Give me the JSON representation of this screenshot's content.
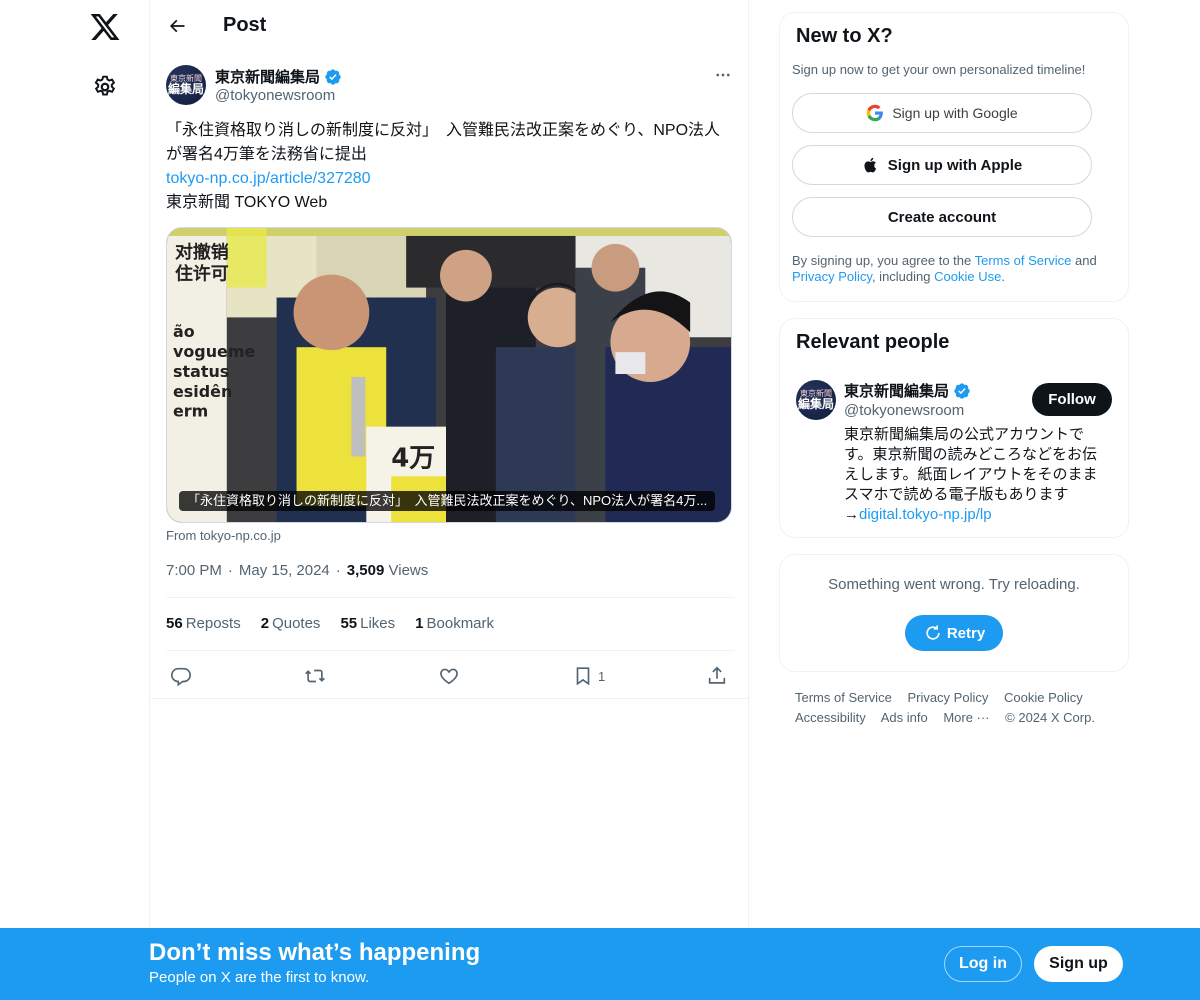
{
  "nav": {
    "logo_icon": "x-logo-icon",
    "settings_icon": "gear-icon"
  },
  "header": {
    "title": "Post"
  },
  "post": {
    "author_name": "東京新聞編集局",
    "author_handle": "@tokyonewsroom",
    "avatar_line1": "東京新聞",
    "avatar_line2": "編集局",
    "text_line": "「永住資格取り消しの新制度に反対」　入管難民法改正案をめぐり、NPO法人が署名4万筆を法務省に提出",
    "link": "tokyo-np.co.jp/article/327280",
    "source": "東京新聞 TOKYO Web",
    "media_caption": "「永住資格取り消しの新制度に反対」　入管難民法改正案をめぐり、NPO法人が署名4万...",
    "from_domain": "From tokyo-np.co.jp",
    "time": "7:00 PM",
    "date": "May 15, 2024",
    "views_count": "3,509",
    "views_label": "Views",
    "stats": {
      "reposts_count": "56",
      "reposts_label": "Reposts",
      "quotes_count": "2",
      "quotes_label": "Quotes",
      "likes_count": "55",
      "likes_label": "Likes",
      "bookmarks_count": "1",
      "bookmarks_label": "Bookmark"
    },
    "bookmark_action_count": "1"
  },
  "signup_panel": {
    "title": "New to X?",
    "subtitle": "Sign up now to get your own personalized timeline!",
    "google_label": "Sign up with Google",
    "apple_label": "Sign up with Apple",
    "create_label": "Create account",
    "legal_prefix": "By signing up, you agree to the ",
    "terms_link": "Terms of Service",
    "legal_and": " and",
    "privacy_link": "Privacy Policy",
    "legal_including": ", including ",
    "cookie_link": "Cookie Use",
    "legal_end": "."
  },
  "relevant": {
    "title": "Relevant people",
    "name": "東京新聞編集局",
    "handle": "@tokyonewsroom",
    "follow_label": "Follow",
    "bio": "東京新聞編集局の公式アカウントです。東京新聞の読みどころなどをお伝えします。紙面レイアウトをそのままスマホで読める電子版もあります→",
    "bio_link": "digital.tokyo-np.jp/lp"
  },
  "error_panel": {
    "message": "Something went wrong. Try reloading.",
    "retry_label": "Retry"
  },
  "footer": {
    "terms": "Terms of Service",
    "privacy": "Privacy Policy",
    "cookie": "Cookie Policy",
    "accessibility": "Accessibility",
    "ads": "Ads info",
    "more": "More ···",
    "copyright": "© 2024 X Corp."
  },
  "banner": {
    "title": "Don’t miss what’s happening",
    "subtitle": "People on X are the first to know.",
    "login_label": "Log in",
    "signup_label": "Sign up"
  },
  "colors": {
    "accent": "#1d9bf0",
    "text": "#0f1419",
    "muted": "#536471",
    "border": "#eff3f4"
  }
}
